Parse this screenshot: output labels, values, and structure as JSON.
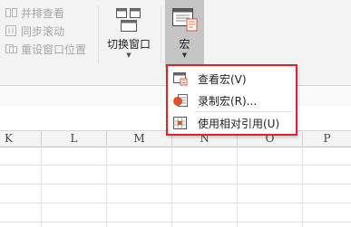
{
  "window_group": {
    "commands": [
      {
        "label": "并排查看",
        "icon": "side-by-side-icon",
        "enabled": false
      },
      {
        "label": "同步滚动",
        "icon": "sync-scroll-icon",
        "enabled": false
      },
      {
        "label": "重设窗口位置",
        "icon": "reset-window-icon",
        "enabled": false
      }
    ],
    "switch_windows": {
      "label": "切换窗口",
      "icon": "switch-windows-icon",
      "caret": "▼"
    }
  },
  "macros": {
    "label": "宏",
    "icon": "macro-icon",
    "caret": "▼",
    "menu": [
      {
        "label": "查看宏(V)",
        "icon": "view-macro-icon"
      },
      {
        "label": "录制宏(R)...",
        "icon": "record-macro-icon"
      },
      {
        "label": "使用相对引用(U)",
        "icon": "relative-reference-icon"
      }
    ]
  },
  "columns": [
    "K",
    "L",
    "M",
    "N",
    "O",
    "P"
  ],
  "colors": {
    "highlight_border": "#e4202a",
    "pressed_button": "#c5c5c5",
    "record_dot": "#d9542b"
  }
}
